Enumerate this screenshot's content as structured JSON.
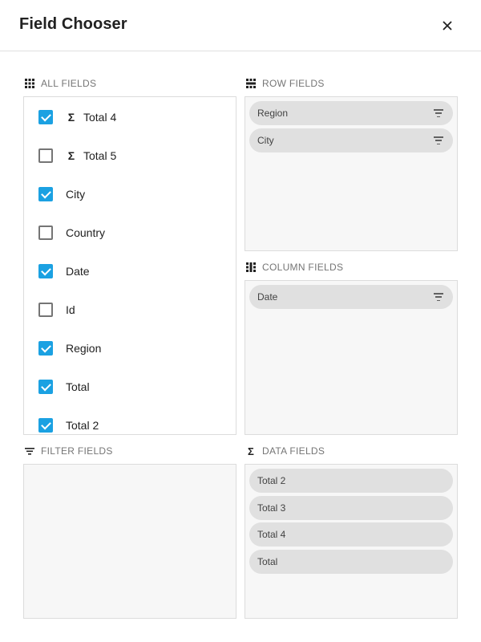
{
  "dialog": {
    "title": "Field Chooser",
    "close_icon": "close-icon"
  },
  "sections": {
    "all_fields": "ALL FIELDS",
    "row_fields": "ROW FIELDS",
    "column_fields": "COLUMN FIELDS",
    "filter_fields": "FILTER FIELDS",
    "data_fields": "DATA FIELDS"
  },
  "all_fields": [
    {
      "label": "Total 4",
      "checked": true,
      "aggregate": true
    },
    {
      "label": "Total 5",
      "checked": false,
      "aggregate": true
    },
    {
      "label": "City",
      "checked": true,
      "aggregate": false
    },
    {
      "label": "Country",
      "checked": false,
      "aggregate": false
    },
    {
      "label": "Date",
      "checked": true,
      "aggregate": false
    },
    {
      "label": "Id",
      "checked": false,
      "aggregate": false
    },
    {
      "label": "Region",
      "checked": true,
      "aggregate": false
    },
    {
      "label": "Total",
      "checked": true,
      "aggregate": false
    },
    {
      "label": "Total 2",
      "checked": true,
      "aggregate": false
    }
  ],
  "row_fields": [
    "Region",
    "City"
  ],
  "column_fields": [
    "Date"
  ],
  "filter_fields": [],
  "data_fields": [
    "Total 2",
    "Total 3",
    "Total 4",
    "Total"
  ],
  "colors": {
    "accent": "#1ba1e2",
    "chip": "#e0e0e0",
    "panel": "#f7f7f7"
  }
}
